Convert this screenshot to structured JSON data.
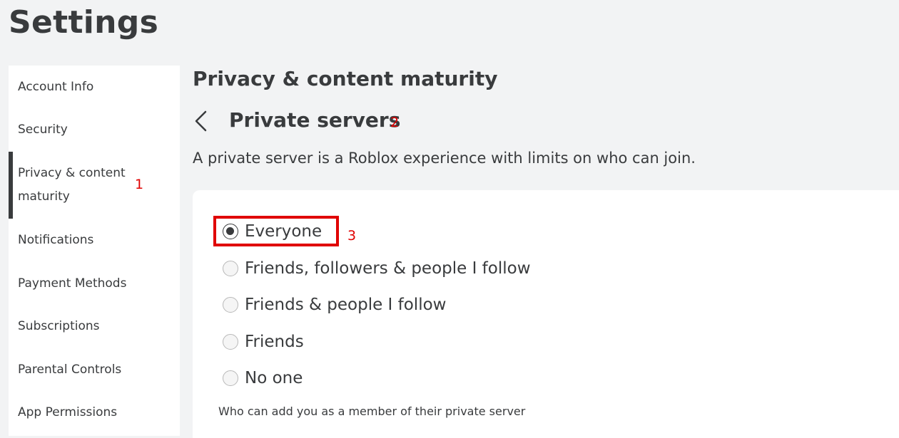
{
  "page": {
    "title": "Settings"
  },
  "sidebar": {
    "items": [
      {
        "label": "Account Info",
        "active": false
      },
      {
        "label": "Security",
        "active": false
      },
      {
        "label": "Privacy & content maturity",
        "active": true
      },
      {
        "label": "Notifications",
        "active": false
      },
      {
        "label": "Payment Methods",
        "active": false
      },
      {
        "label": "Subscriptions",
        "active": false
      },
      {
        "label": "Parental Controls",
        "active": false
      },
      {
        "label": "App Permissions",
        "active": false
      }
    ]
  },
  "main": {
    "section_title": "Privacy & content maturity",
    "back_icon": "chevron-left-icon",
    "subsection_title": "Private servers",
    "description": "A private server is a Roblox experience with limits on who can join.",
    "radio_options": [
      {
        "label": "Everyone",
        "selected": true
      },
      {
        "label": "Friends, followers & people I follow",
        "selected": false
      },
      {
        "label": "Friends & people I follow",
        "selected": false
      },
      {
        "label": "Friends",
        "selected": false
      },
      {
        "label": "No one",
        "selected": false
      }
    ],
    "footnote": "Who can add you as a member of their private server"
  },
  "annotations": {
    "marker_1": "1",
    "marker_2": "2",
    "marker_3": "3",
    "color": "#e00000"
  }
}
